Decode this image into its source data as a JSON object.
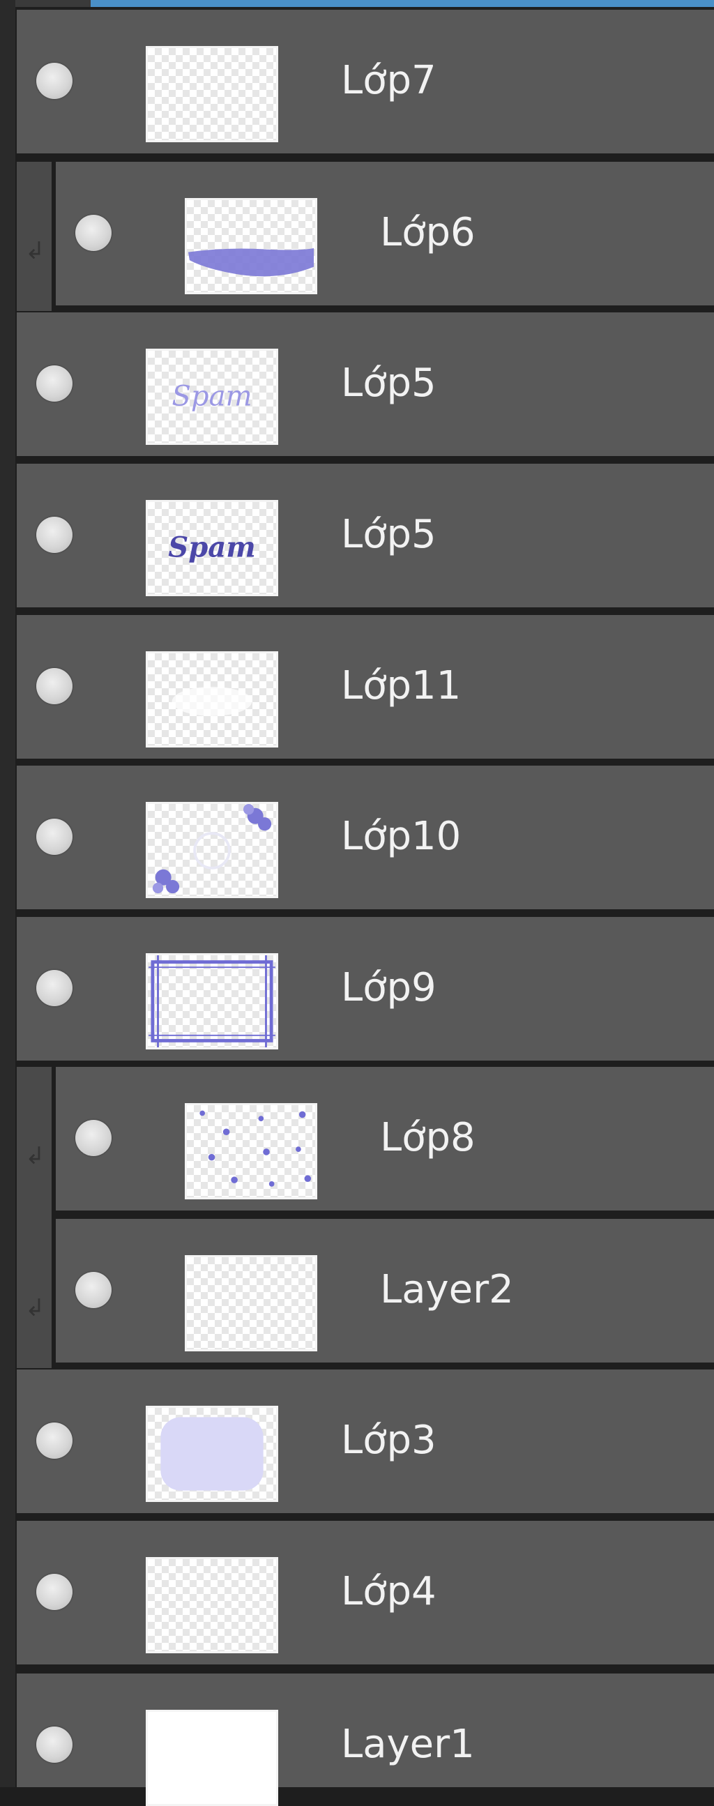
{
  "layers_panel": {
    "layers": [
      {
        "name": "Lớp7",
        "clipped": false,
        "thumb": "blank"
      },
      {
        "name": "Lớp6",
        "clipped": true,
        "thumb": "brush-stroke"
      },
      {
        "name": "Lớp5",
        "clipped": false,
        "thumb": "text-light"
      },
      {
        "name": "Lớp5",
        "clipped": false,
        "thumb": "text-dark"
      },
      {
        "name": "Lớp11",
        "clipped": false,
        "thumb": "blank"
      },
      {
        "name": "Lớp10",
        "clipped": false,
        "thumb": "corner-flowers"
      },
      {
        "name": "Lớp9",
        "clipped": false,
        "thumb": "frame"
      },
      {
        "name": "Lớp8",
        "clipped": true,
        "thumb": "dots"
      },
      {
        "name": "Layer2",
        "clipped": true,
        "thumb": "blank"
      },
      {
        "name": "Lớp3",
        "clipped": false,
        "thumb": "lavender-fill"
      },
      {
        "name": "Lớp4",
        "clipped": false,
        "thumb": "blank"
      },
      {
        "name": "Layer1",
        "clipped": false,
        "thumb": "white"
      }
    ],
    "thumb_texts": {
      "text_light": "Spam",
      "text_dark": "Spam"
    }
  },
  "colors": {
    "row_bg": "#595959",
    "panel_bg": "#1e1e1e",
    "accent": "#4a90c8",
    "art_purple": "#7b78d6"
  }
}
